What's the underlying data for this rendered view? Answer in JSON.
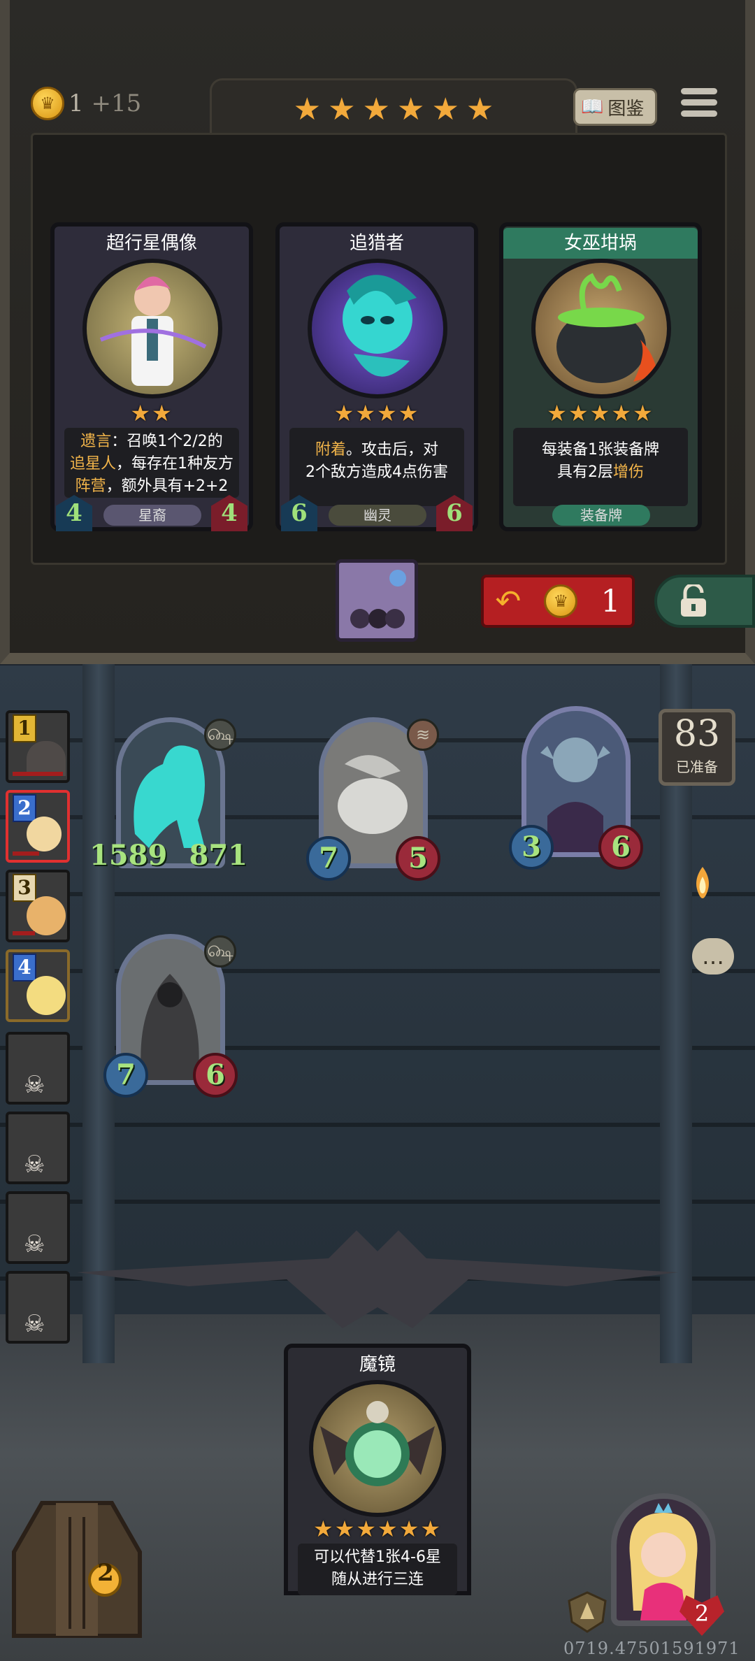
{
  "header": {
    "gold": "1",
    "gold_income": "+15",
    "tavern_stars": 6,
    "codex_label": "图鉴"
  },
  "shop": {
    "cards": [
      {
        "name": "超行星偶像",
        "stars": "★★",
        "desc_lines": [
          "遗言：召唤1个2/2的",
          "追星人，每存在1种友方",
          "阵营，额外具有+2+2"
        ],
        "highlights": [
          "遗言",
          "追星人",
          "阵营"
        ],
        "tribe": "星裔",
        "attack": "4",
        "health": "4"
      },
      {
        "name": "追猎者",
        "stars": "★★★★",
        "desc_lines": [
          "附着。攻击后，对",
          "2个敌方造成4点伤害"
        ],
        "highlights": [
          "附着"
        ],
        "tribe": "幽灵",
        "attack": "6",
        "health": "6"
      },
      {
        "name": "女巫坩埚",
        "stars": "★★★★★",
        "desc_lines": [
          "每装备1张装备牌",
          "具有2层增伤"
        ],
        "highlights": [
          "增伤"
        ],
        "tribe": "装备牌",
        "attack": "",
        "health": ""
      }
    ],
    "refresh_cost": "1"
  },
  "warband": {
    "roster": [
      {
        "rank": "1",
        "dead": false
      },
      {
        "rank": "2",
        "dead": false,
        "active": true
      },
      {
        "rank": "3",
        "dead": false
      },
      {
        "rank": "4",
        "dead": false
      },
      {
        "rank": "",
        "dead": true
      },
      {
        "rank": "",
        "dead": true
      },
      {
        "rank": "",
        "dead": true
      },
      {
        "rank": "",
        "dead": true
      }
    ],
    "minions": [
      {
        "attack": "1589",
        "health": "871"
      },
      {
        "attack": "7",
        "health": "5"
      },
      {
        "attack": "3",
        "health": "6"
      },
      {
        "attack": "7",
        "health": "6"
      }
    ],
    "ready_count": "83",
    "ready_label": "已准备"
  },
  "hand": {
    "card_name": "魔镜",
    "stars": "★★★★★★",
    "desc_lines": [
      "可以代替1张4-6星",
      "随从进行三连"
    ]
  },
  "player": {
    "chest_count": "2",
    "hero_health": "2"
  },
  "footer": {
    "coordinates": "0719.47501591971"
  },
  "colors": {
    "star": "#f2a93b",
    "highlight": "#f3b54a",
    "refresh": "#b51f22",
    "stat_text": "#a8e37f"
  }
}
